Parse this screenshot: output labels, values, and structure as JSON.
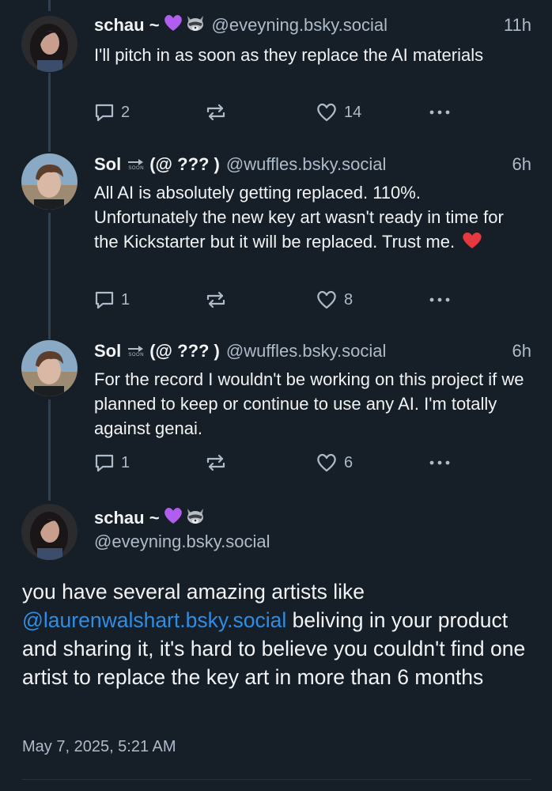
{
  "colors": {
    "background": "#161e27",
    "text_primary": "#f1f3f5",
    "text_secondary": "#aebbc9",
    "link": "#2e8ee6",
    "thread_line": "#2e4052",
    "heart_red": "#e5393f",
    "heart_purple": "#b15df0"
  },
  "posts": [
    {
      "display_name": "schau ~",
      "name_emojis": [
        "purple-heart",
        "raccoon"
      ],
      "handle": "@eveyning.bsky.social",
      "time": "11h",
      "text": "I'll pitch in as soon as they replace the AI materials",
      "replies": "2",
      "reposts": "",
      "likes": "14"
    },
    {
      "display_name": "Sol",
      "name_suffix": "(@ ??? )",
      "name_icon": "soon-arrow",
      "name_icon_text": "SOON",
      "handle": "@wuffles.bsky.social",
      "time": "6h",
      "text": "All AI is absolutely getting replaced. 110%. Unfortunately the new key art wasn't ready in time for the Kickstarter but it will be replaced. Trust me.",
      "text_emoji": "red-heart",
      "replies": "1",
      "reposts": "",
      "likes": "8"
    },
    {
      "display_name": "Sol",
      "name_suffix": "(@ ??? )",
      "name_icon": "soon-arrow",
      "name_icon_text": "SOON",
      "handle": "@wuffles.bsky.social",
      "time": "6h",
      "text": "For the record I wouldn't be working on this project if we planned to keep or continue to use any AI. I'm totally against genai.",
      "replies": "1",
      "reposts": "",
      "likes": "6"
    }
  ],
  "main_post": {
    "display_name": "schau ~",
    "name_emojis": [
      "purple-heart",
      "raccoon"
    ],
    "handle": "@eveyning.bsky.social",
    "text_before": "you have several amazing artists like ",
    "mention": "@laurenwalshart.bsky.social",
    "text_after": " beliving in your product and sharing it, it's hard to believe you couldn't find one artist to replace the key art in more than 6 months",
    "timestamp": "May 7, 2025, 5:21 AM"
  }
}
